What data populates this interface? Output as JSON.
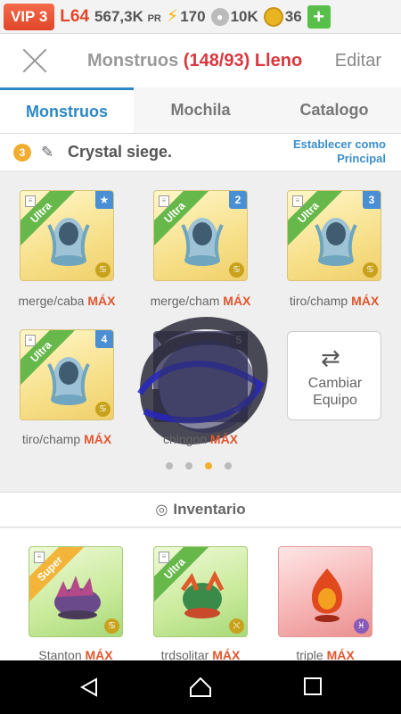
{
  "topbar": {
    "vip": "VIP 3",
    "level": "L64",
    "power": "567,3K",
    "power_unit": "PR",
    "energy": "170",
    "food": "10K",
    "coins": "36",
    "add_label": "+"
  },
  "header": {
    "title_prefix": "Monstruos",
    "title_count": "(148/93)",
    "title_status": "Lleno",
    "edit_label": "Editar"
  },
  "tabs": [
    {
      "label": "Monstruos",
      "active": true
    },
    {
      "label": "Mochila",
      "active": false
    },
    {
      "label": "Catalogo",
      "active": false
    }
  ],
  "team": {
    "number": "3",
    "name": "Crystal siege.",
    "set_main_label": "Establecer como Principal"
  },
  "team_monsters": [
    {
      "name": "merge/caba",
      "max": "MÁX",
      "rarity": "Ultra",
      "slot": "★",
      "element": "♋"
    },
    {
      "name": "merge/cham",
      "max": "MÁX",
      "rarity": "Ultra",
      "slot": "2",
      "element": "♋"
    },
    {
      "name": "tiro/champ",
      "max": "MÁX",
      "rarity": "Ultra",
      "slot": "3",
      "element": "♋"
    },
    {
      "name": "tiro/champ",
      "max": "MÁX",
      "rarity": "Ultra",
      "slot": "4",
      "element": "♋"
    },
    {
      "name": "chingon",
      "max": "MÁX",
      "rarity": "Epic",
      "slot": "5",
      "element": "♋"
    }
  ],
  "swap_button": {
    "label_line1": "Cambiar",
    "label_line2": "Equipo",
    "icon": "swap-arrows-icon"
  },
  "pagination": {
    "pages": 4,
    "current": 3
  },
  "inventory": {
    "title": "Inventario",
    "items": [
      {
        "name": "Stanton",
        "max": "MÁX",
        "rarity": "Super",
        "element": "♋"
      },
      {
        "name": "trdsolitar",
        "max": "MÁX",
        "rarity": "Ultra",
        "element": "⛌"
      },
      {
        "name": "triple",
        "max": "MÁX",
        "rarity": "",
        "element": "♓"
      }
    ]
  },
  "navbar": {
    "back": "back-icon",
    "home": "home-icon",
    "recents": "recents-icon"
  },
  "colors": {
    "accent": "#2d88c6",
    "warning": "#d9373d",
    "max": "#e2562e",
    "ultra": "#67b84a",
    "super": "#f2b53a"
  }
}
